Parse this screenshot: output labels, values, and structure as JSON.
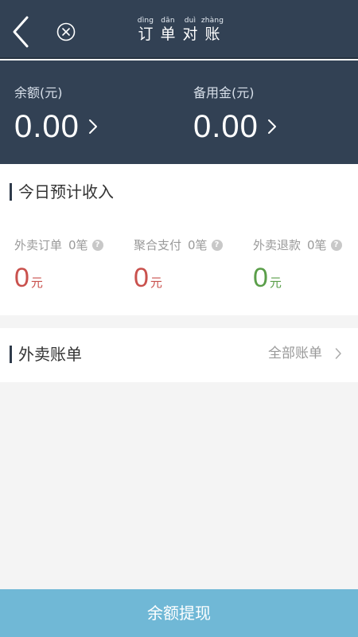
{
  "header": {
    "title_chars": [
      {
        "pinyin": "dìng",
        "hanzi": "订"
      },
      {
        "pinyin": "dān",
        "hanzi": "单"
      },
      {
        "pinyin": "duì",
        "hanzi": "对"
      },
      {
        "pinyin": "zhàng",
        "hanzi": "账"
      }
    ],
    "back_icon": "chevron-left-icon",
    "close_icon": "close-circle-icon"
  },
  "balance": {
    "balance_label": "余额(元)",
    "balance_value": "0.00",
    "reserve_label": "备用金(元)",
    "reserve_value": "0.00"
  },
  "income": {
    "title": "今日预计收入",
    "stats": [
      {
        "label": "外卖订单",
        "count": "0笔",
        "value": "0",
        "unit": "元",
        "color": "#c9514d"
      },
      {
        "label": "聚合支付",
        "count": "0笔",
        "value": "0",
        "unit": "元",
        "color": "#c9514d"
      },
      {
        "label": "外卖退款",
        "count": "0笔",
        "value": "0",
        "unit": "元",
        "color": "#5a9e49"
      }
    ]
  },
  "bills": {
    "title": "外卖账单",
    "all_link": "全部账单"
  },
  "footer": {
    "withdraw_label": "余额提现"
  },
  "colors": {
    "header_bg": "#324154",
    "footer_bg": "#70b8d6",
    "red_value": "#c9514d",
    "green_value": "#5a9e49"
  }
}
